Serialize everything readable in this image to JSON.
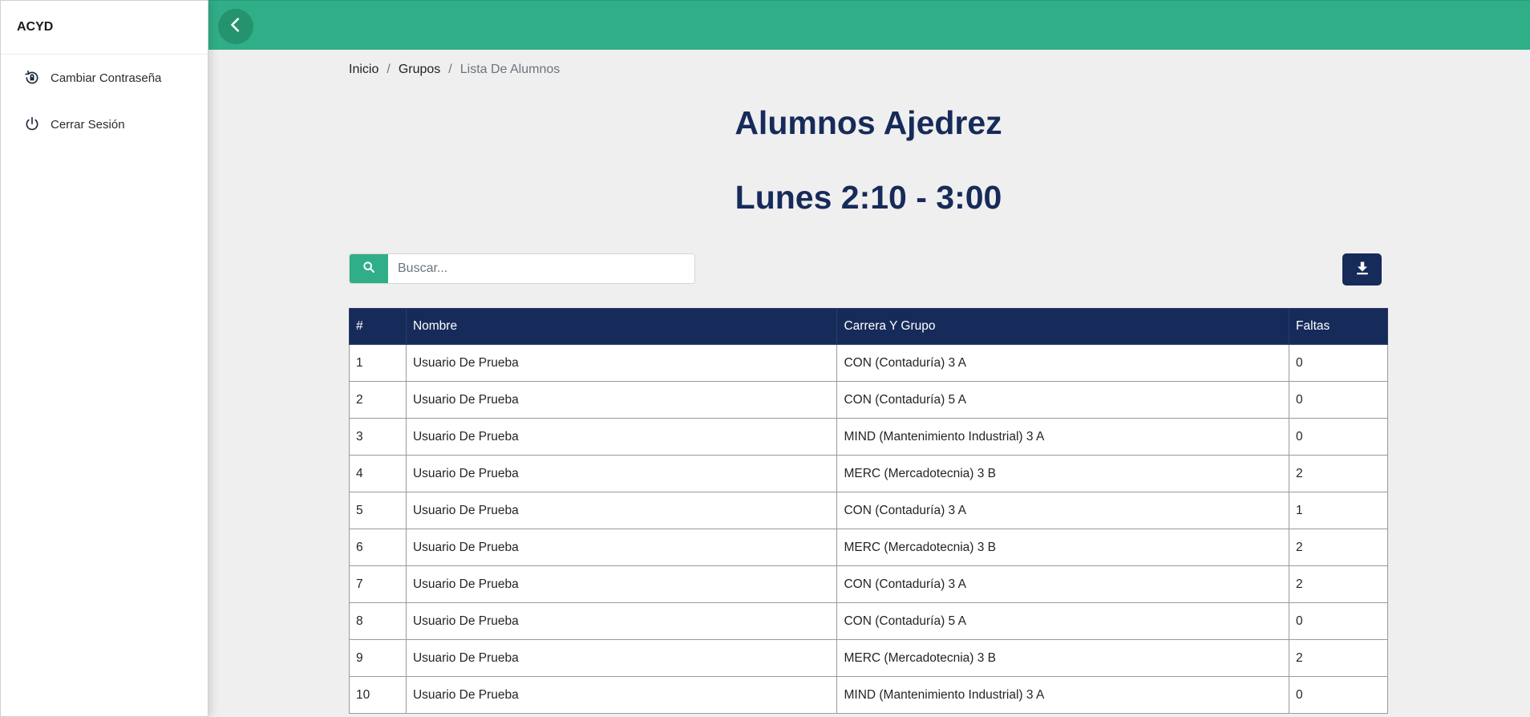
{
  "sidebar": {
    "brand": "ACYD",
    "items": [
      {
        "label": "Cambiar Contraseña",
        "icon": "lock-reset-icon"
      },
      {
        "label": "Cerrar Sesión",
        "icon": "power-icon"
      }
    ]
  },
  "topbar": {
    "back_icon": "chevron-left-icon",
    "color": "#30ae88"
  },
  "breadcrumb": {
    "home": "Inicio",
    "groups": "Grupos",
    "current": "Lista De Alumnos"
  },
  "header": {
    "title": "Alumnos Ajedrez",
    "schedule": "Lunes 2:10 - 3:00"
  },
  "search": {
    "placeholder": "Buscar...",
    "value": ""
  },
  "download": {
    "icon": "download-icon"
  },
  "table": {
    "headers": [
      "#",
      "Nombre",
      "Carrera Y Grupo",
      "Faltas"
    ],
    "rows": [
      [
        "1",
        "Usuario De Prueba",
        "CON (Contaduría) 3 A",
        "0"
      ],
      [
        "2",
        "Usuario De Prueba",
        "CON (Contaduría) 5 A",
        "0"
      ],
      [
        "3",
        "Usuario De Prueba",
        "MIND (Mantenimiento Industrial) 3 A",
        "0"
      ],
      [
        "4",
        "Usuario De Prueba",
        "MERC (Mercadotecnia) 3 B",
        "2"
      ],
      [
        "5",
        "Usuario De Prueba",
        "CON (Contaduría) 3 A",
        "1"
      ],
      [
        "6",
        "Usuario De Prueba",
        "MERC (Mercadotecnia) 3 B",
        "2"
      ],
      [
        "7",
        "Usuario De Prueba",
        "CON (Contaduría) 3 A",
        "2"
      ],
      [
        "8",
        "Usuario De Prueba",
        "CON (Contaduría) 5 A",
        "0"
      ],
      [
        "9",
        "Usuario De Prueba",
        "MERC (Mercadotecnia) 3 B",
        "2"
      ],
      [
        "10",
        "Usuario De Prueba",
        "MIND (Mantenimiento Industrial) 3 A",
        "0"
      ]
    ]
  },
  "colors": {
    "primary": "#30ae88",
    "navy": "#172b5a",
    "background": "#efefef"
  }
}
